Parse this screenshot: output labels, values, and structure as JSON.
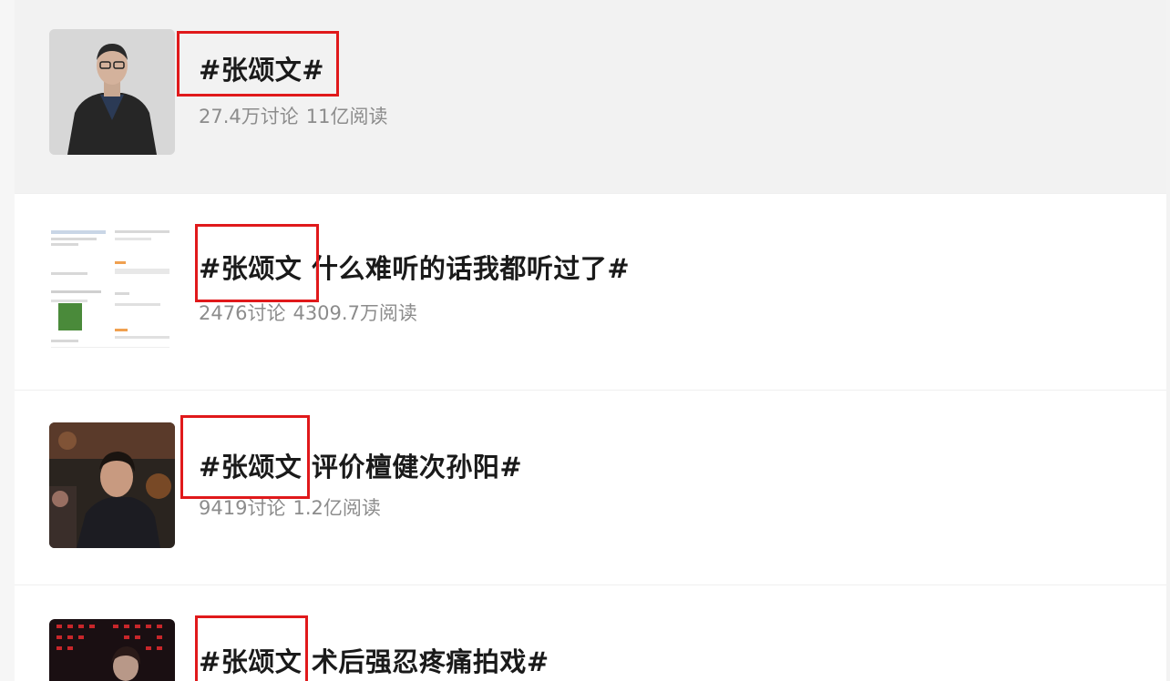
{
  "topics": [
    {
      "title": "#张颂文#",
      "discussions": "27.4万讨论",
      "reads": "11亿阅读",
      "thumbnail": "person-in-dark-coat-photo"
    },
    {
      "title": "#张颂文 什么难听的话我都听过了#",
      "discussions": "2476讨论",
      "reads": "4309.7万阅读",
      "thumbnail": "weibo-post-screenshot"
    },
    {
      "title": "#张颂文 评价檀健次孙阳#",
      "discussions": "9419讨论",
      "reads": "1.2亿阅读",
      "thumbnail": "drama-still-photo"
    },
    {
      "title": "#张颂文 术后强忍疼痛拍戏#",
      "discussions": "",
      "reads": "",
      "thumbnail": "filming-scene-photo"
    }
  ],
  "colors": {
    "highlight": "#e0191b",
    "title": "#1a1a1a",
    "meta": "#8c8c8c",
    "active_row": "#f2f2f2"
  }
}
